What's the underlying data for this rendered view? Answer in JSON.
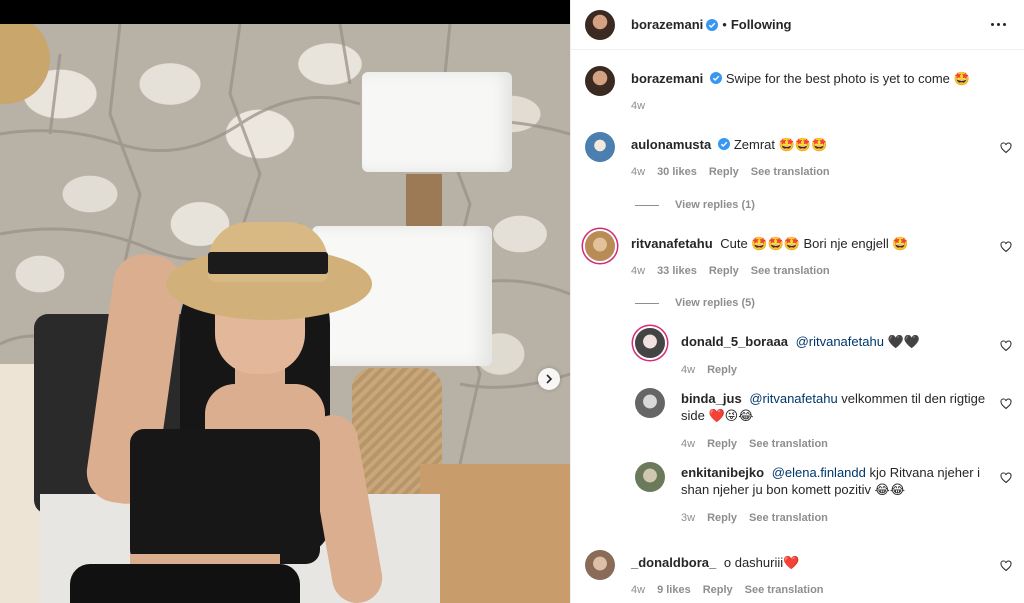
{
  "post": {
    "author": "borazemani",
    "follow_state": "Following",
    "caption": "Swipe for the best photo is yet to come 🤩",
    "caption_ago": "4w"
  },
  "comments": [
    {
      "user": "aulonamusta",
      "verified": true,
      "text": "Zemrat 🤩🤩🤩",
      "ago": "4w",
      "likes": "30 likes",
      "reply": "Reply",
      "translate": "See translation",
      "view_replies": "View replies (1)"
    },
    {
      "user": "ritvanafetahu",
      "text": "Cute 🤩🤩🤩 Bori nje engjell 🤩",
      "ago": "4w",
      "likes": "33 likes",
      "reply": "Reply",
      "translate": "See translation",
      "view_replies": "View replies (5)",
      "replies": [
        {
          "user": "donald_5_boraaa",
          "mention": "@ritvanafetahu",
          "text": "🖤🖤",
          "ago": "4w",
          "reply": "Reply"
        },
        {
          "user": "binda_jus",
          "mention": "@ritvanafetahu",
          "text": "velkommen til den rigtige side ❤️😜😂",
          "ago": "4w",
          "reply": "Reply",
          "translate": "See translation"
        },
        {
          "user": "enkitanibejko",
          "mention": "@elena.finlandd",
          "text": "kjo Ritvana njeher i shan njeher ju bon komett pozitiv 😂😂",
          "ago": "3w",
          "reply": "Reply",
          "translate": "See translation"
        }
      ]
    },
    {
      "user": "_donaldbora_",
      "text": "o dashuriii❤️",
      "ago": "4w",
      "likes": "9 likes",
      "reply": "Reply",
      "translate": "See translation"
    }
  ],
  "icons": {
    "verified": "verified-badge-icon",
    "more": "more-options-icon",
    "heart": "heart-outline-icon",
    "next": "chevron-right-icon"
  },
  "colors": {
    "verified": "#3897f0",
    "meta": "#8e8e8e",
    "mention": "#00376b",
    "ring": "#d62976"
  }
}
